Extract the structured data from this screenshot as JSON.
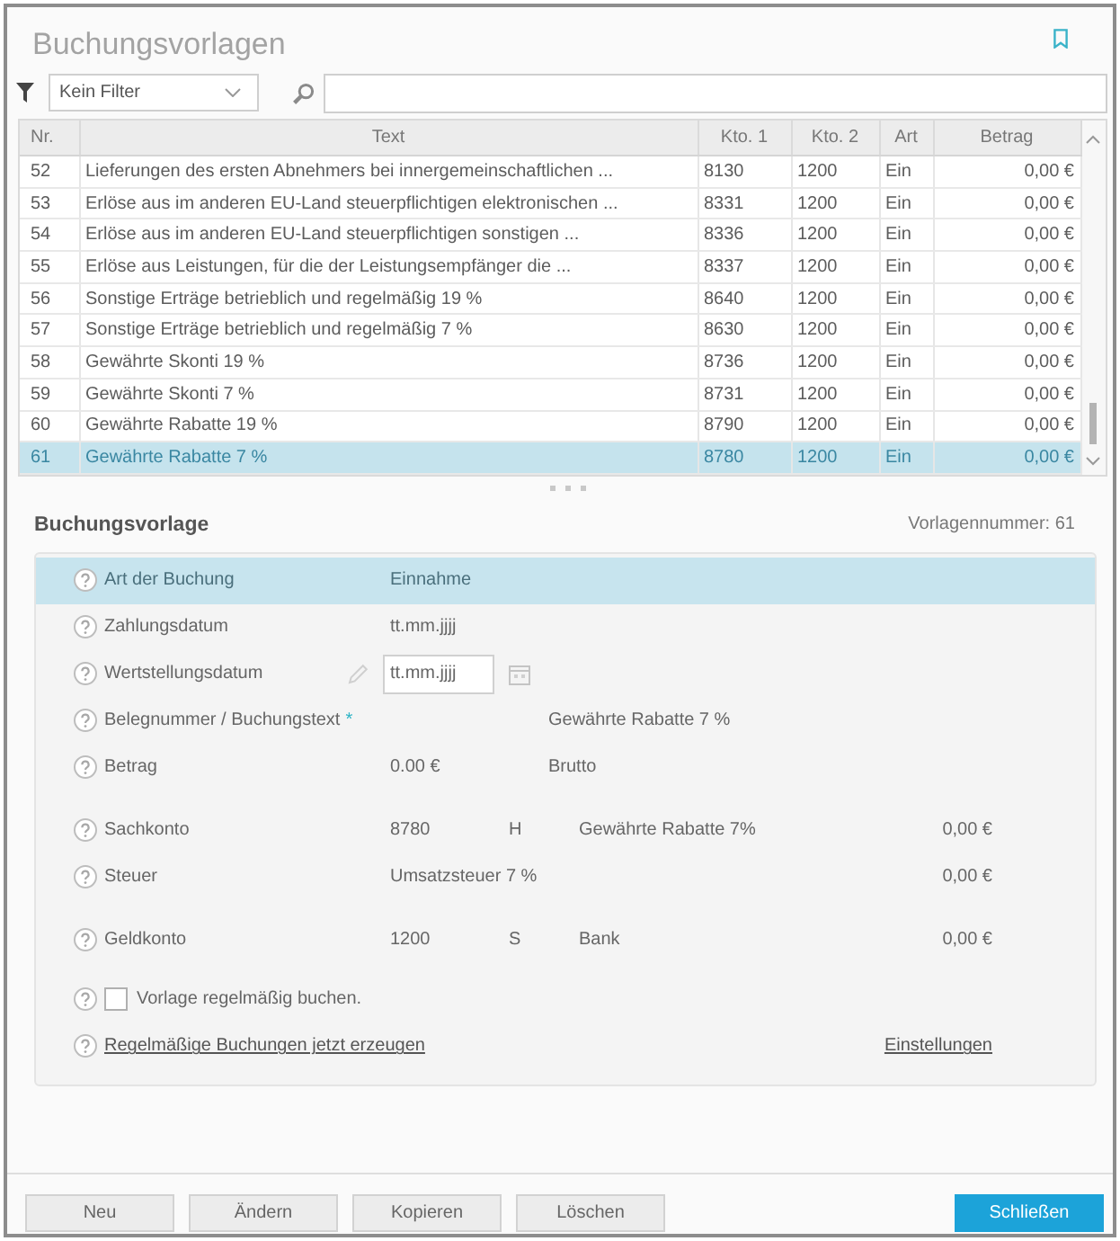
{
  "window": {
    "title": "Buchungsvorlagen"
  },
  "filter": {
    "value": "Kein Filter"
  },
  "table": {
    "columns": [
      "Nr.",
      "Text",
      "Kto. 1",
      "Kto. 2",
      "Art",
      "Betrag"
    ],
    "rows": [
      {
        "nr": "52",
        "text": "Lieferungen des ersten Abnehmers bei innergemeinschaftlichen ...",
        "kto_1": "8130",
        "kto_2": "1200",
        "art": "Ein",
        "betrag": "0,00 €",
        "selected": false
      },
      {
        "nr": "53",
        "text": "Erlöse aus im anderen EU-Land steuerpflichtigen elektronischen ...",
        "kto_1": "8331",
        "kto_2": "1200",
        "art": "Ein",
        "betrag": "0,00 €",
        "selected": false
      },
      {
        "nr": "54",
        "text": "Erlöse aus im anderen EU-Land steuerpflichtigen sonstigen ...",
        "kto_1": "8336",
        "kto_2": "1200",
        "art": "Ein",
        "betrag": "0,00 €",
        "selected": false
      },
      {
        "nr": "55",
        "text": "Erlöse aus Leistungen, für die der Leistungsempfänger die ...",
        "kto_1": "8337",
        "kto_2": "1200",
        "art": "Ein",
        "betrag": "0,00 €",
        "selected": false
      },
      {
        "nr": "56",
        "text": "Sonstige Erträge betrieblich und regelmäßig 19 %",
        "kto_1": "8640",
        "kto_2": "1200",
        "art": "Ein",
        "betrag": "0,00 €",
        "selected": false
      },
      {
        "nr": "57",
        "text": "Sonstige Erträge betrieblich und regelmäßig 7 %",
        "kto_1": "8630",
        "kto_2": "1200",
        "art": "Ein",
        "betrag": "0,00 €",
        "selected": false
      },
      {
        "nr": "58",
        "text": "Gewährte Skonti 19 %",
        "kto_1": "8736",
        "kto_2": "1200",
        "art": "Ein",
        "betrag": "0,00 €",
        "selected": false
      },
      {
        "nr": "59",
        "text": "Gewährte Skonti 7 %",
        "kto_1": "8731",
        "kto_2": "1200",
        "art": "Ein",
        "betrag": "0,00 €",
        "selected": false
      },
      {
        "nr": "60",
        "text": "Gewährte Rabatte 19 %",
        "kto_1": "8790",
        "kto_2": "1200",
        "art": "Ein",
        "betrag": "0,00 €",
        "selected": false
      },
      {
        "nr": "61",
        "text": "Gewährte Rabatte 7 %",
        "kto_1": "8780",
        "kto_2": "1200",
        "art": "Ein",
        "betrag": "0,00 €",
        "selected": true
      }
    ]
  },
  "detail": {
    "title": "Buchungsvorlage",
    "template_number": "Vorlagennummer: 61",
    "rows": [
      {
        "kind": "value",
        "label": "Art der Buchung",
        "value": "Einnahme",
        "selected": true
      },
      {
        "kind": "value",
        "label": "Zahlungsdatum",
        "value": "tt.mm.jjjj",
        "selected": false
      },
      {
        "kind": "date",
        "label": "Wertstellungsdatum",
        "value": "tt.mm.jjjj",
        "selected": false
      },
      {
        "kind": "text",
        "label": "Belegnummer / Buchungstext",
        "required_mark": "*",
        "value": "Gewährte Rabatte 7 %",
        "selected": false
      },
      {
        "kind": "amount",
        "label": "Betrag",
        "value": "0.00 €",
        "mode": "Brutto",
        "selected": false
      },
      {
        "kind": "account",
        "label": "Sachkonto",
        "account": "8780",
        "side": "H",
        "name": "Gewährte Rabatte 7%",
        "amount": "0,00 €",
        "selected": false
      },
      {
        "kind": "tax",
        "label": "Steuer",
        "value": "Umsatzsteuer 7 %",
        "amount": "0,00 €",
        "selected": false
      },
      {
        "kind": "account",
        "label": "Geldkonto",
        "account": "1200",
        "side": "S",
        "name": "Bank",
        "amount": "0,00 €",
        "selected": false
      },
      {
        "kind": "checkbox",
        "label": "Vorlage regelmäßig buchen.",
        "checked": false,
        "selected": false
      },
      {
        "kind": "links",
        "link": "Regelmäßige Buchungen jetzt erzeugen",
        "link_right": "Einstellungen",
        "selected": false
      }
    ]
  },
  "buttons": [
    {
      "label": "Neu",
      "kind": "default"
    },
    {
      "label": "Ändern",
      "kind": "default"
    },
    {
      "label": "Kopieren",
      "kind": "default"
    },
    {
      "label": "Löschen",
      "kind": "default"
    },
    {
      "label": "Schließen",
      "kind": "primary"
    }
  ]
}
